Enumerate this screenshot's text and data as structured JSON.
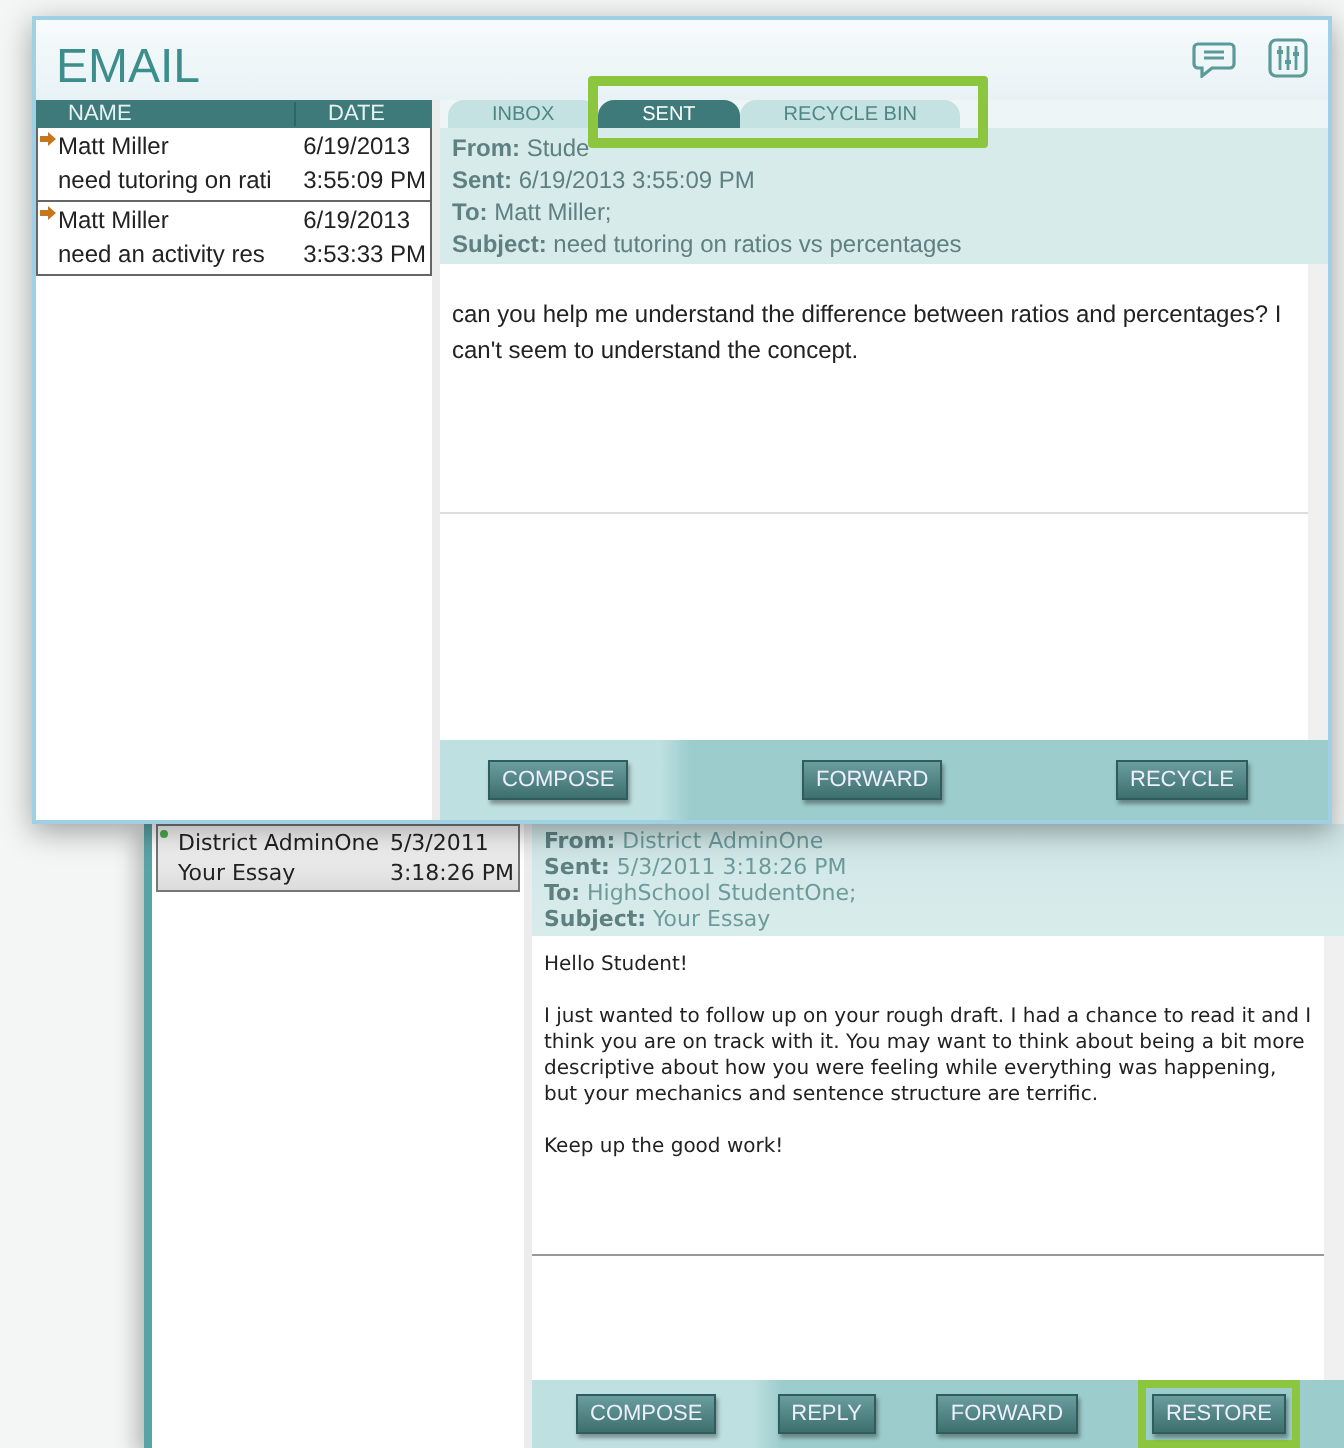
{
  "front_window": {
    "title": "EMAIL",
    "columns": [
      "NAME",
      "DATE"
    ],
    "tabs_highlighted": true,
    "tabs": [
      {
        "label": "INBOX",
        "selected": false
      },
      {
        "label": "SENT",
        "selected": true
      },
      {
        "label": "RECYCLE BIN",
        "selected": false
      }
    ],
    "messages": [
      {
        "kind": "sent",
        "name": "Matt Miller",
        "date": "6/19/2013",
        "subject": "need tutoring on rati",
        "time": "3:55:09 PM"
      },
      {
        "kind": "sent",
        "name": "Matt Miller",
        "date": "6/19/2013",
        "subject": "need an activity res",
        "time": "3:53:33 PM"
      }
    ],
    "reading": {
      "from_label": "From:",
      "from": "Stude",
      "sent_label": "Sent:",
      "sent": "6/19/2013 3:55:09 PM",
      "to_label": "To:",
      "to": "Matt Miller;",
      "subject_label": "Subject:",
      "subject": "need tutoring on ratios vs percentages",
      "body": [
        "can you help me understand the difference between ratios and percentages? I can't seem to understand the concept."
      ]
    },
    "buttons": [
      {
        "label": "COMPOSE",
        "highlighted": false
      },
      {
        "label": "FORWARD",
        "highlighted": false
      },
      {
        "label": "RECYCLE",
        "highlighted": false
      }
    ]
  },
  "back_window": {
    "messages": [
      {
        "kind": "unread",
        "name": "District AdminOne",
        "date": "5/3/2011",
        "subject": "Your Essay",
        "time": "3:18:26 PM"
      }
    ],
    "reading": {
      "from_label": "From:",
      "from": "District AdminOne",
      "sent_label": "Sent:",
      "sent": "5/3/2011 3:18:26 PM",
      "to_label": "To:",
      "to": "HighSchool StudentOne;",
      "subject_label": "Subject:",
      "subject": "Your Essay",
      "body": [
        "Hello Student!",
        "I just wanted to follow up on your rough draft. I had a chance to read it and I think you are on track with it. You may want to think about being a bit more descriptive about how you were feeling while everything was happening, but your mechanics and sentence structure are terrific.",
        "Keep up the good work!"
      ]
    },
    "buttons": [
      {
        "label": "COMPOSE",
        "highlighted": false
      },
      {
        "label": "REPLY",
        "highlighted": false
      },
      {
        "label": "FORWARD",
        "highlighted": false
      },
      {
        "label": "RESTORE",
        "highlighted": true
      }
    ]
  }
}
